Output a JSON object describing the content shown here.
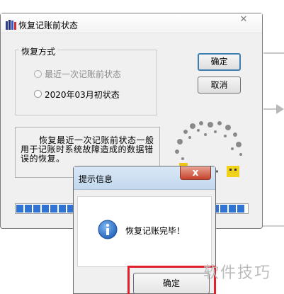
{
  "main_dialog": {
    "title": "恢复记账前状态",
    "close_glyph": "✕",
    "group_label": "恢复方式",
    "options": [
      {
        "label": "最近一次记账前状态",
        "enabled": false,
        "selected": false
      },
      {
        "label": "2020年03月初状态",
        "enabled": true,
        "selected": false
      }
    ],
    "ok_label": "确定",
    "cancel_label": "取消",
    "description": "恢复最近一次记账前状态一般用于记账时系统故障造成的数据错误的恢复。",
    "progress_fraction": 1.0
  },
  "message_box": {
    "title": "提示信息",
    "close_glyph": "x",
    "message": "恢复记账完毕！",
    "ok_label": "确定"
  },
  "watermark": "软件技巧",
  "colors": {
    "progress_block": "#2f73d6",
    "highlight": "#e0202a",
    "focus_border": "#3c7fb1"
  }
}
